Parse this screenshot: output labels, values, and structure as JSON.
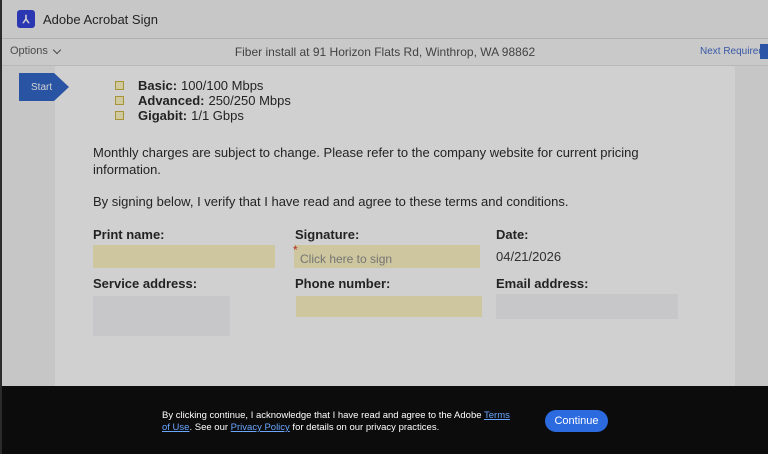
{
  "app": {
    "logo_glyph": "⅄",
    "title": "Adobe Acrobat Sign"
  },
  "toolbar": {
    "options_label": "Options",
    "document_title": "Fiber install at 91 Horizon Flats Rd, Winthrop, WA 98862",
    "next_required_label": "Next Required"
  },
  "start_tab": {
    "label": "Start"
  },
  "plans": [
    {
      "name": "Basic:",
      "speed": "100/100 Mbps"
    },
    {
      "name": "Advanced:",
      "speed": "250/250 Mbps"
    },
    {
      "name": "Gigabit:",
      "speed": "1/1 Gbps"
    }
  ],
  "terms": {
    "pricing_note": "Monthly charges are subject to change. Please refer to the company website for current pricing information.",
    "agreement": "By signing below, I verify that I have read and agree to these terms and conditions."
  },
  "form": {
    "print_name_label": "Print name:",
    "signature_label": "Signature:",
    "signature_placeholder": "Click here to sign",
    "required_marker": "*",
    "date_label": "Date:",
    "date_value": "04/21/2026",
    "service_address_label": "Service address:",
    "phone_number_label": "Phone number:",
    "email_address_label": "Email address:"
  },
  "consent": {
    "text_before": "By clicking continue, I acknowledge that I have read and agree to the Adobe ",
    "terms_link": "Terms of Use",
    "text_middle": ". See our ",
    "privacy_link": "Privacy Policy",
    "text_after": " for details on our privacy practices.",
    "continue_label": "Continue"
  },
  "colors": {
    "accent": "#2a60c7",
    "field_highlight": "#fbf3bf",
    "banner_bg": "#0c0c0c",
    "link": "#6aa6ff"
  }
}
